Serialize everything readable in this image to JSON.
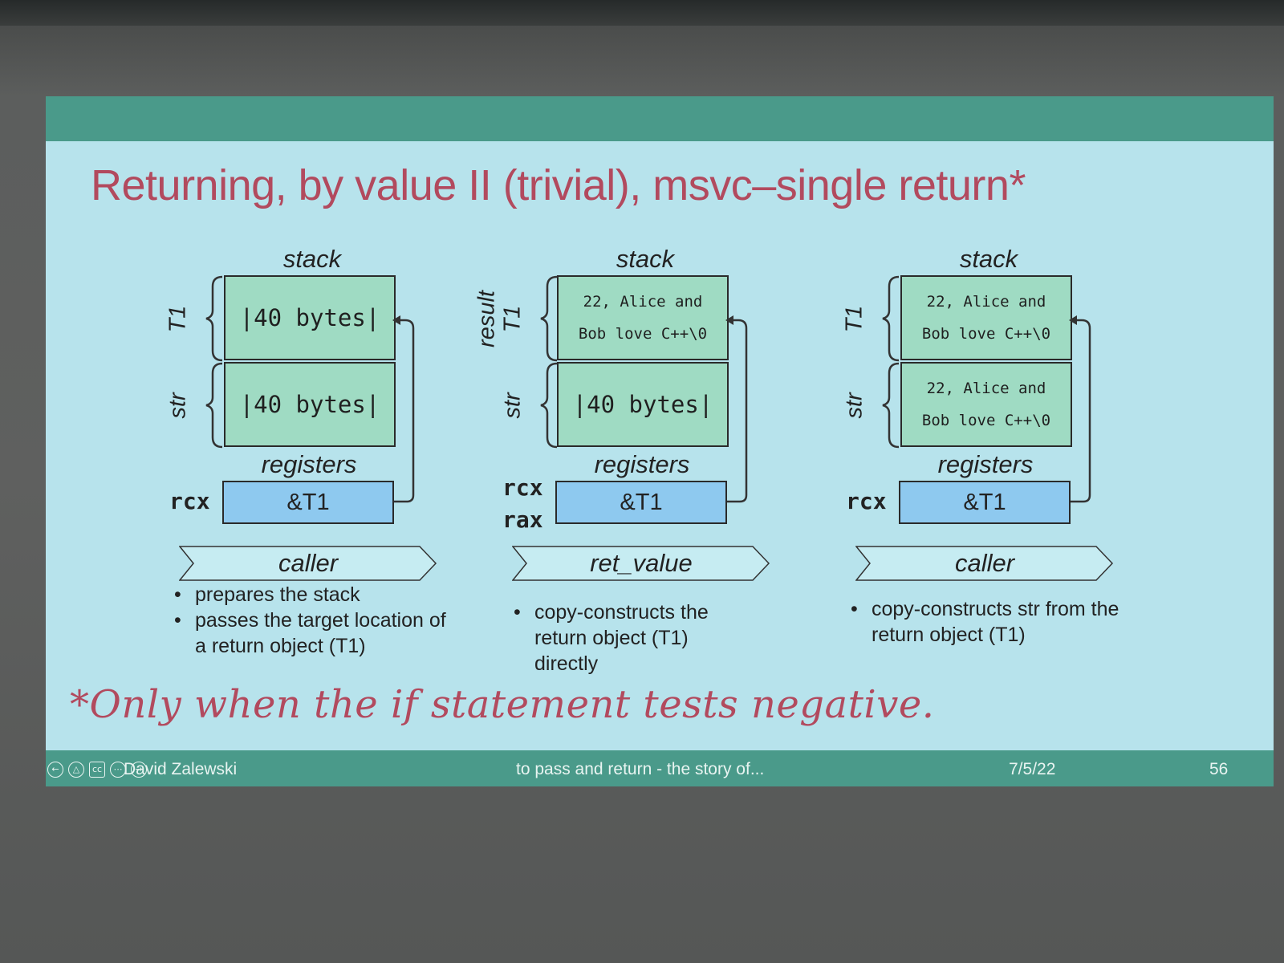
{
  "slide": {
    "title": "Returning, by value II (trivial), msvc–single return*",
    "footnote": "*Only when the if statement tests negative."
  },
  "footer": {
    "author": "David Zalewski",
    "talk": "to pass and return - the story of...",
    "date": "7/5/22",
    "page": "56"
  },
  "panels": [
    {
      "stack_label": "stack",
      "registers_label": "registers",
      "slot1_label": "T1",
      "slot2_label": "str",
      "slot1_value": "|40 bytes|",
      "slot2_value": "|40 bytes|",
      "register_name": "rcx",
      "register_value": "&T1",
      "phase": "caller",
      "bullets": [
        "prepares the stack",
        "passes the target location of a return object (T1)"
      ]
    },
    {
      "stack_label": "stack",
      "registers_label": "registers",
      "slot1_label_top": "result",
      "slot1_label": "T1",
      "slot2_label": "str",
      "slot1_value_line1": "22, Alice and",
      "slot1_value_line2": "Bob love C++\\0",
      "slot2_value": "|40 bytes|",
      "register_name": "rcx",
      "register_name2": "rax",
      "register_value": "&T1",
      "phase": "ret_value",
      "bullets": [
        "copy-constructs the return object (T1) directly"
      ]
    },
    {
      "stack_label": "stack",
      "registers_label": "registers",
      "slot1_label": "T1",
      "slot2_label": "str",
      "slot1_value_line1": "22, Alice and",
      "slot1_value_line2": "Bob love C++\\0",
      "slot2_value_line1": "22, Alice and",
      "slot2_value_line2": "Bob love C++\\0",
      "register_name": "rcx",
      "register_value": "&T1",
      "phase": "caller",
      "bullets": [
        "copy-constructs str from the return object (T1)"
      ]
    }
  ],
  "colors": {
    "slide_bg": "#b7e3ec",
    "bar": "#4a9a8a",
    "title": "#b24a5e",
    "stack_cell": "#9fdbc3",
    "register_cell": "#8ec9ef"
  },
  "icons": [
    "back-icon",
    "pointer-icon",
    "captions-icon",
    "more-icon",
    "forward-icon"
  ]
}
